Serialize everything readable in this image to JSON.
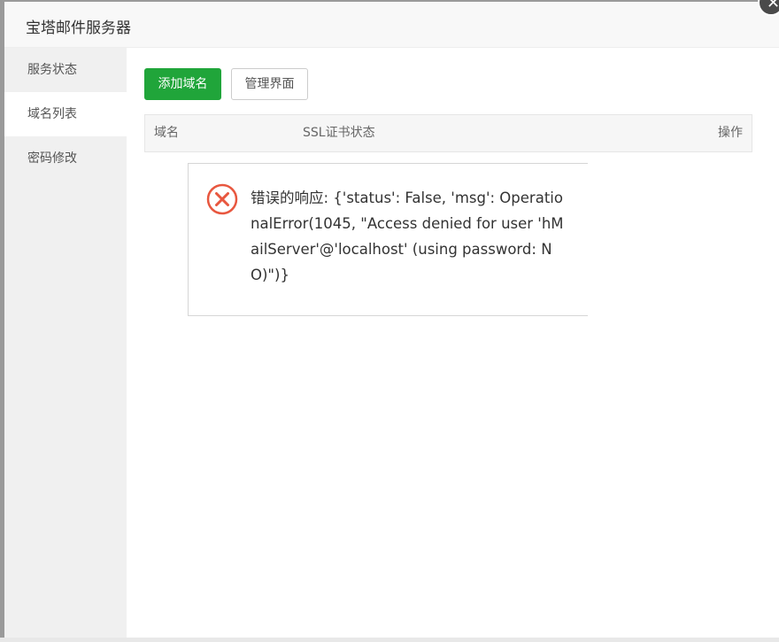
{
  "dialog": {
    "title": "宝塔邮件服务器",
    "close_glyph": "✕"
  },
  "sidebar": {
    "items": [
      {
        "label": "服务状态",
        "active": false
      },
      {
        "label": "域名列表",
        "active": true
      },
      {
        "label": "密码修改",
        "active": false
      }
    ]
  },
  "toolbar": {
    "add_domain_label": "添加域名",
    "manage_label": "管理界面"
  },
  "table": {
    "columns": [
      "域名",
      "SSL证书状态",
      "操作"
    ]
  },
  "error": {
    "icon": "error-circle-icon",
    "message": "错误的响应: {'status': False, 'msg': OperationalError(1045, \"Access denied for user 'hMailServer'@'localhost' (using password: NO)\")}"
  },
  "colors": {
    "primary": "#20a53a",
    "error": "#e8573f",
    "sidebar_bg": "#f0f0f0"
  }
}
